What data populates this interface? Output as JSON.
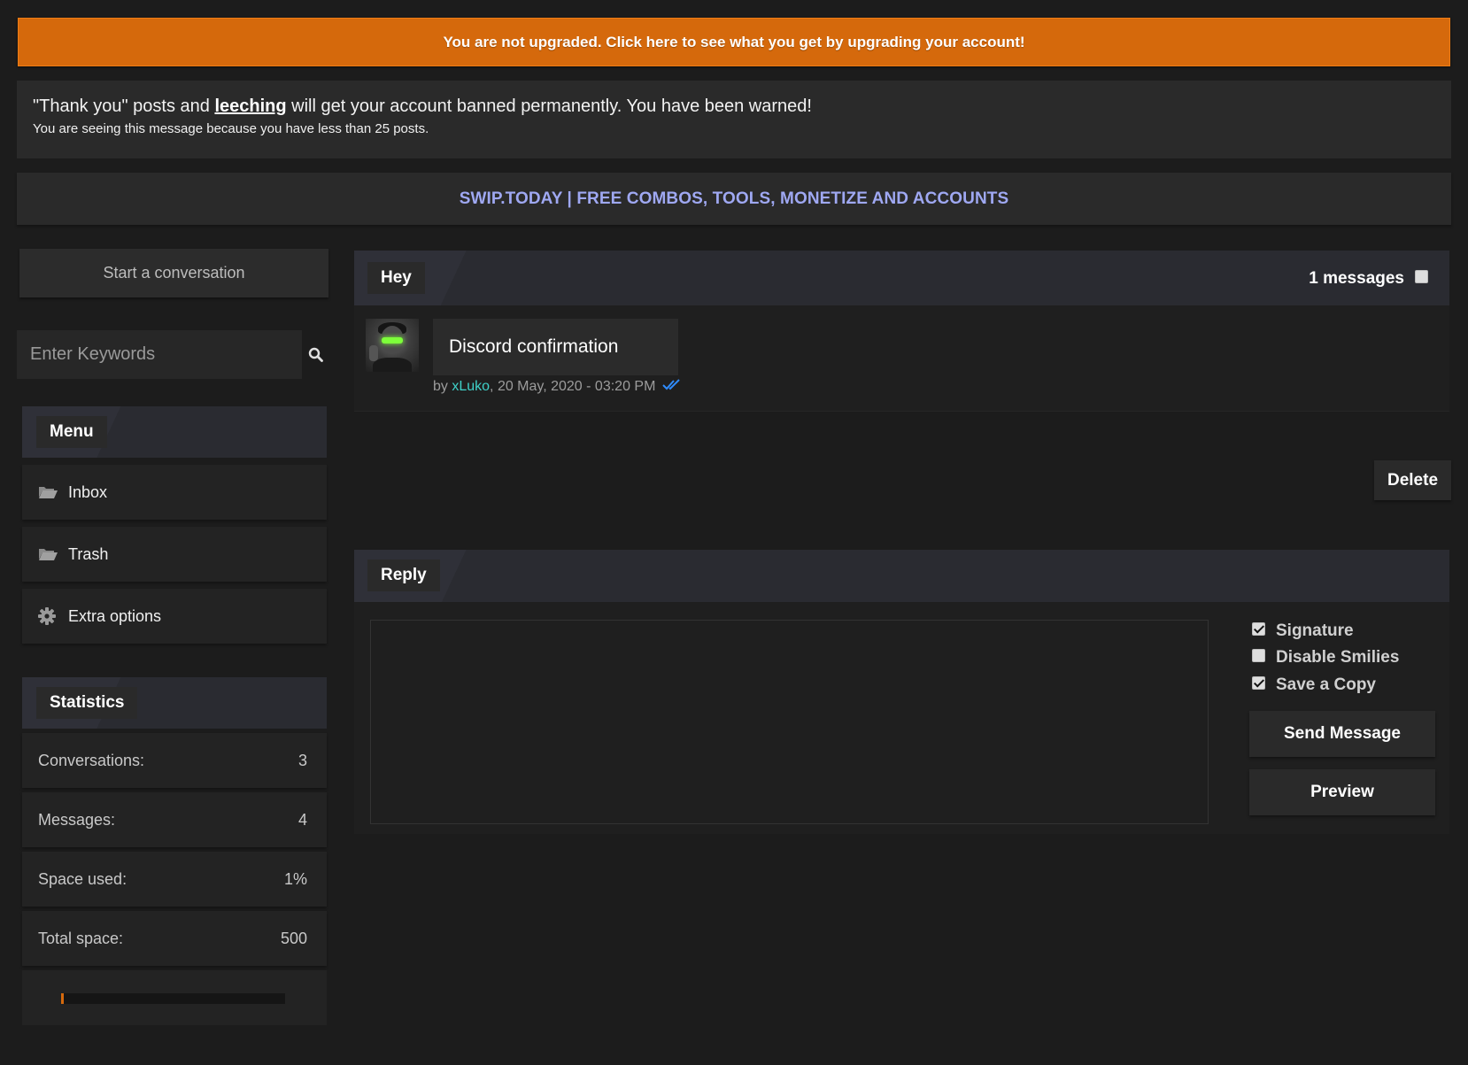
{
  "upgrade_banner": {
    "text": "You are not upgraded. Click here to see what you get by upgrading your account!"
  },
  "warning": {
    "prefix": "\"Thank you\" posts and ",
    "link": "leeching",
    "suffix": " will get your account banned permanently. You have been warned!",
    "subtext": "You are seeing this message because you have less than 25 posts."
  },
  "site_banner": {
    "text": "SWIP.TODAY | FREE COMBOS, TOOLS, MONETIZE AND ACCOUNTS"
  },
  "sidebar": {
    "start_conversation": "Start a conversation",
    "search_placeholder": "Enter Keywords",
    "menu_title": "Menu",
    "menu_items": [
      {
        "label": "Inbox",
        "icon": "folder-open-icon"
      },
      {
        "label": "Trash",
        "icon": "folder-open-icon"
      },
      {
        "label": "Extra options",
        "icon": "gear-icon"
      }
    ],
    "stats_title": "Statistics",
    "stats": [
      {
        "label": "Conversations:",
        "value": "3"
      },
      {
        "label": "Messages:",
        "value": "4"
      },
      {
        "label": "Space used:",
        "value": "1%"
      },
      {
        "label": "Total space:",
        "value": "500"
      }
    ],
    "space_used_fraction": 0.01
  },
  "conversation": {
    "title": "Hey",
    "message_count": "1 messages",
    "select_all_checked": false,
    "message": {
      "subject": "Discord confirmation",
      "by": "by ",
      "author": "xLuko",
      "date": ", 20 May, 2020 - 03:20 PM"
    },
    "delete_label": "Delete"
  },
  "reply": {
    "title": "Reply",
    "textarea_value": "",
    "options": [
      {
        "label": "Signature",
        "checked": true
      },
      {
        "label": "Disable Smilies",
        "checked": false
      },
      {
        "label": "Save a Copy",
        "checked": true
      }
    ],
    "send_label": "Send Message",
    "preview_label": "Preview"
  },
  "colors": {
    "upgrade_banner": "#d5690c",
    "site_banner_text": "#9fa8f2",
    "author_link": "#3fd1c9",
    "read_check": "#2f8cff"
  }
}
